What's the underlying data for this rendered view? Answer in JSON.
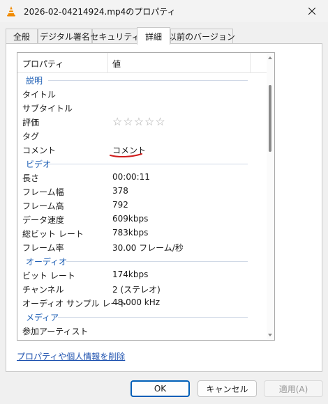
{
  "window": {
    "title": "2026-02-04214924.mp4のプロパティ",
    "app_icon": "vlc-cone-icon",
    "close_icon": "close-icon"
  },
  "tabs": [
    {
      "label": "全般",
      "active": false
    },
    {
      "label": "デジタル署名",
      "active": false
    },
    {
      "label": "セキュリティ",
      "active": false
    },
    {
      "label": "詳細",
      "active": true
    },
    {
      "label": "以前のバージョン",
      "active": false
    }
  ],
  "details": {
    "column_property": "プロパティ",
    "column_value": "値",
    "description_group": "説明",
    "title_label": "タイトル",
    "subtitle_label": "サブタイトル",
    "rating_label": "評価",
    "rating_value": 0,
    "rating_max": 5,
    "tags_label": "タグ",
    "comment_label": "コメント",
    "comment_value": "コメント",
    "video_group": "ビデオ",
    "length_label": "長さ",
    "length_value": "00:00:11",
    "frame_width_label": "フレーム幅",
    "frame_width_value": "378",
    "frame_height_label": "フレーム高",
    "frame_height_value": "792",
    "data_rate_label": "データ速度",
    "data_rate_value": "609kbps",
    "total_bitrate_label": "総ビット レート",
    "total_bitrate_value": "783kbps",
    "frame_rate_label": "フレーム率",
    "frame_rate_value": "30.00 フレーム/秒",
    "audio_group": "オーディオ",
    "bitrate_label": "ビット レート",
    "bitrate_value": "174kbps",
    "channels_label": "チャンネル",
    "channels_value": "2 (ステレオ)",
    "sample_rate_label": "オーディオ サンプル レート",
    "sample_rate_value": "48.000 kHz",
    "media_group": "メディア",
    "contributing_artist_label": "参加アーティスト"
  },
  "remove_link": "プロパティや個人情報を削除",
  "buttons": {
    "ok": "OK",
    "cancel": "キャンセル",
    "apply": "適用(A)"
  },
  "colors": {
    "group_label": "#1e5fb5",
    "link": "#1b4fae",
    "ok_border": "#005fb8",
    "annotation_underline": "#d01c1c"
  }
}
